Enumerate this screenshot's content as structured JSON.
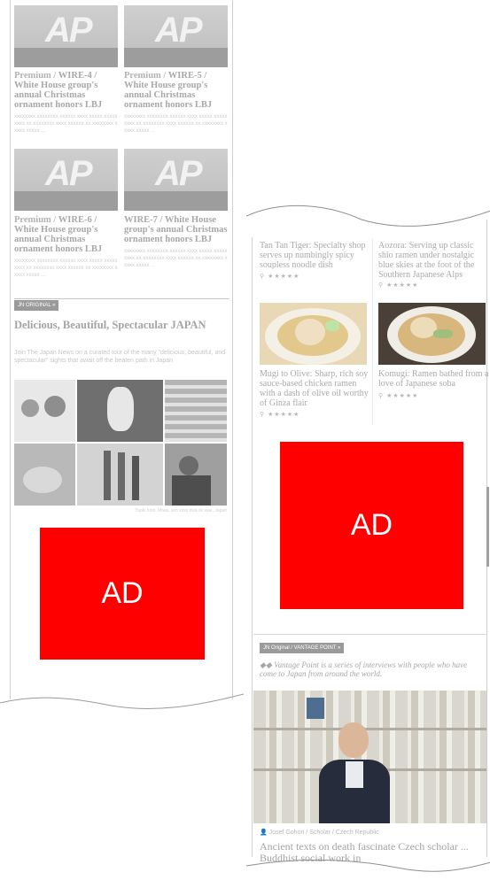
{
  "left": {
    "articles": [
      {
        "kind": "Premium / ",
        "title": "WIRE-4 / White House group's annual Christmas ornament honors LBJ",
        "excerpt": "xxxxxxxx xxxxxxxx xxxxxx xxxx xxxxx xxxxx xxxx xx xxxxxxxx xxxx xxxxxx xx xxxxxxxx xxxxx xxxxx ..."
      },
      {
        "kind": "Premium / ",
        "title": "WIRE-5 / White House group's annual Christmas ornament honors LBJ",
        "excerpt": "xxxxxxxx xxxxxxxx xxxxxx xxxx xxxxx xxxxx xxxx xx xxxxxxxx xxxx xxxxxx xx xxxxxxxx xxxxx xxxxx ..."
      },
      {
        "kind": "Premium / ",
        "title": "WIRE-6 / White House group's annual Christmas ornament honors LBJ",
        "excerpt": "xxxxxxxx xxxxxxxx xxxxxx xxxx xxxxx xxxxx xxxx xx xxxxxxxx xxxx xxxxxx xx xxxxxxxx xxxxx xxxxx ..."
      },
      {
        "kind": "",
        "title": "WIRE-7 / White House group's annual Christmas ornament honors LBJ",
        "excerpt": "xxxxxxxx xxxxxxxx xxxxxx xxxx xxxxx xxxxx xxxx xx xxxxxxxx xxxx xxxxxx xx xxxxxxxx xxxxx xxxxx ..."
      }
    ],
    "jn_tag": "JN ORIGINAL",
    "feature_title": "Delicious, Beautiful, Spectacular JAPAN",
    "feature_desc": "Join The Japan News on a curated tour of the many \"delicious, beautiful, and spectacular\" sights that await off the beaten path in Japan",
    "feature_caption": "Yaoki hoto, Miwa, sen xxxx hwa xk wae, Japan",
    "ad_label": "AD",
    "logo_text": "AP"
  },
  "right": {
    "top_cards": [
      {
        "title": "Tan Tan Tiger: Specialty shop serves up numbingly spicy soupless noodle dish"
      },
      {
        "title": "Aozora: Serving up classic shio ramen under nostalgic blue skies at the foot of the Southern Japanese Alps"
      }
    ],
    "cards": [
      {
        "title": "Mugi to Olive: Sharp, rich soy sauce-based chicken ramen with a dash of olive oil worthy of Ginza flair"
      },
      {
        "title": "Komugi: Ramen bathed from a love of Japanese soba"
      }
    ],
    "stars": "★★★★★",
    "ad_label": "AD",
    "vp_tag": "JN Original / VANTAGE POINT",
    "vp_intro": "Vantage Point is a series of interviews with people who have come to Japan from around the world.",
    "vp_byline": "Josef Gohon / Scholar / Czech Republic",
    "vp_title": "Ancient texts on death fascinate Czech scholar ... Buddhist social work in"
  }
}
